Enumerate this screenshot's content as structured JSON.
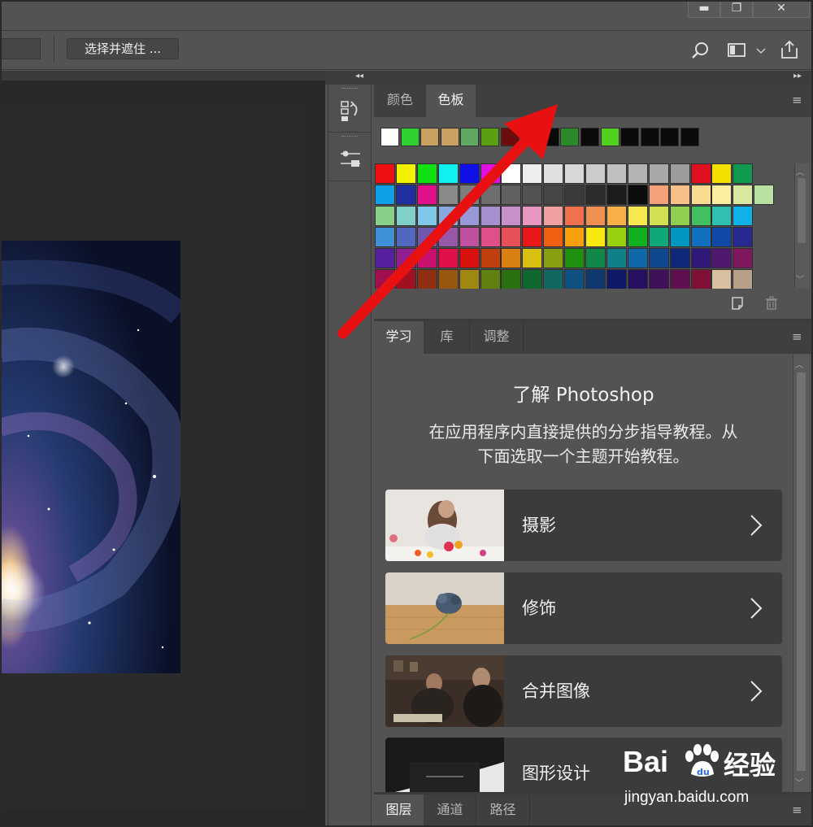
{
  "window_controls": {
    "minimize": "▬",
    "restore": "❐",
    "close": "✕"
  },
  "options_bar": {
    "select_and_mask": "选择并遮住 ..."
  },
  "swatches_panel": {
    "tabs": [
      "颜色",
      "色板"
    ],
    "active_tab": "色板",
    "recent_colors": [
      "#ffffff",
      "#30d030",
      "#c8a060",
      "#c8a060",
      "#60a860",
      "#5aa010",
      "#6b0d0d",
      "#1a1a1a",
      "#0a0a0a",
      "#2a8a2a",
      "#0a0a0a",
      "#52d020",
      "#0a0a0a",
      "#0a0a0a",
      "#0a0a0a",
      "#0a0a0a"
    ],
    "grid_colors": [
      [
        "#ee1010",
        "#f2f200",
        "#10e010",
        "#10f0f0",
        "#1010e8",
        "#e010e0",
        "#ffffff",
        "#eeeeee",
        "#e0e0e0",
        "#d8d8d8",
        "#cccccc",
        "#c0c0c0",
        "#b4b4b4",
        "#a8a8a8",
        "#9c9c9c",
        "#e01020",
        "#f4e000",
        "#109a50"
      ],
      [
        "#10a0e8",
        "#2030a0",
        "#e0108a",
        "#8a8a8a",
        "#7c7c7c",
        "#6e6e6e",
        "#606060",
        "#525252",
        "#464646",
        "#3a3a3a",
        "#2c2c2c",
        "#1c1c1c",
        "#0c0c0c",
        "#f4a078",
        "#f6c088",
        "#fadc90",
        "#fcf0a0",
        "#d8e8a0",
        "#b8e0a0"
      ],
      [
        "#88d088",
        "#80d0c8",
        "#80c8e8",
        "#88a8e0",
        "#9898d8",
        "#a890d0",
        "#c890c8",
        "#e898c0",
        "#f0a0a0",
        "#f07050",
        "#f09050",
        "#f8b048",
        "#f8e850",
        "#d0e050",
        "#90d050",
        "#40c060",
        "#30c0b0",
        "#10b0e8"
      ],
      [
        "#4090d8",
        "#5068c0",
        "#7058b0",
        "#9858a8",
        "#c050a0",
        "#e05088",
        "#e85058",
        "#e81818",
        "#f06010",
        "#f8a010",
        "#f8e810",
        "#98d010",
        "#10b020",
        "#10a878",
        "#0098c0",
        "#1070c0",
        "#1048a8",
        "#282890"
      ],
      [
        "#5820a0",
        "#902090",
        "#c81070",
        "#e01048",
        "#d81010",
        "#c04010",
        "#d88010",
        "#d8c010",
        "#88a010",
        "#209010",
        "#108848",
        "#108088",
        "#1068a8",
        "#104890",
        "#102878",
        "#301878",
        "#501870",
        "#801860"
      ],
      [
        "#a01050",
        "#a01020",
        "#903010",
        "#985810",
        "#a08810",
        "#608010",
        "#287010",
        "#106830",
        "#106860",
        "#105080",
        "#103870",
        "#101868",
        "#281060",
        "#401058",
        "#601050",
        "#801038",
        "#d8c0a0",
        "#b8a088"
      ]
    ],
    "footer_icons": [
      "new-swatch-icon",
      "trash-icon"
    ]
  },
  "learn_panel": {
    "tabs": [
      "学习",
      "库",
      "调整"
    ],
    "active_tab": "学习",
    "title": "了解 Photoshop",
    "description_line1": "在应用程序内直接提供的分步指导教程。从",
    "description_line2": "下面选取一个主题开始教程。",
    "topics": [
      {
        "label": "摄影"
      },
      {
        "label": "修饰"
      },
      {
        "label": "合并图像"
      },
      {
        "label": "图形设计"
      }
    ]
  },
  "layers_panel": {
    "tabs": [
      "图层",
      "通道",
      "路径"
    ],
    "active_tab": "图层"
  },
  "watermark": {
    "brand_prefix": "Bai",
    "brand_suffix": "经验",
    "url": "jingyan.baidu.com"
  },
  "colors": {
    "annotation_arrow": "#e81010",
    "panel_bg": "#535353",
    "dark_bg": "#282828"
  }
}
